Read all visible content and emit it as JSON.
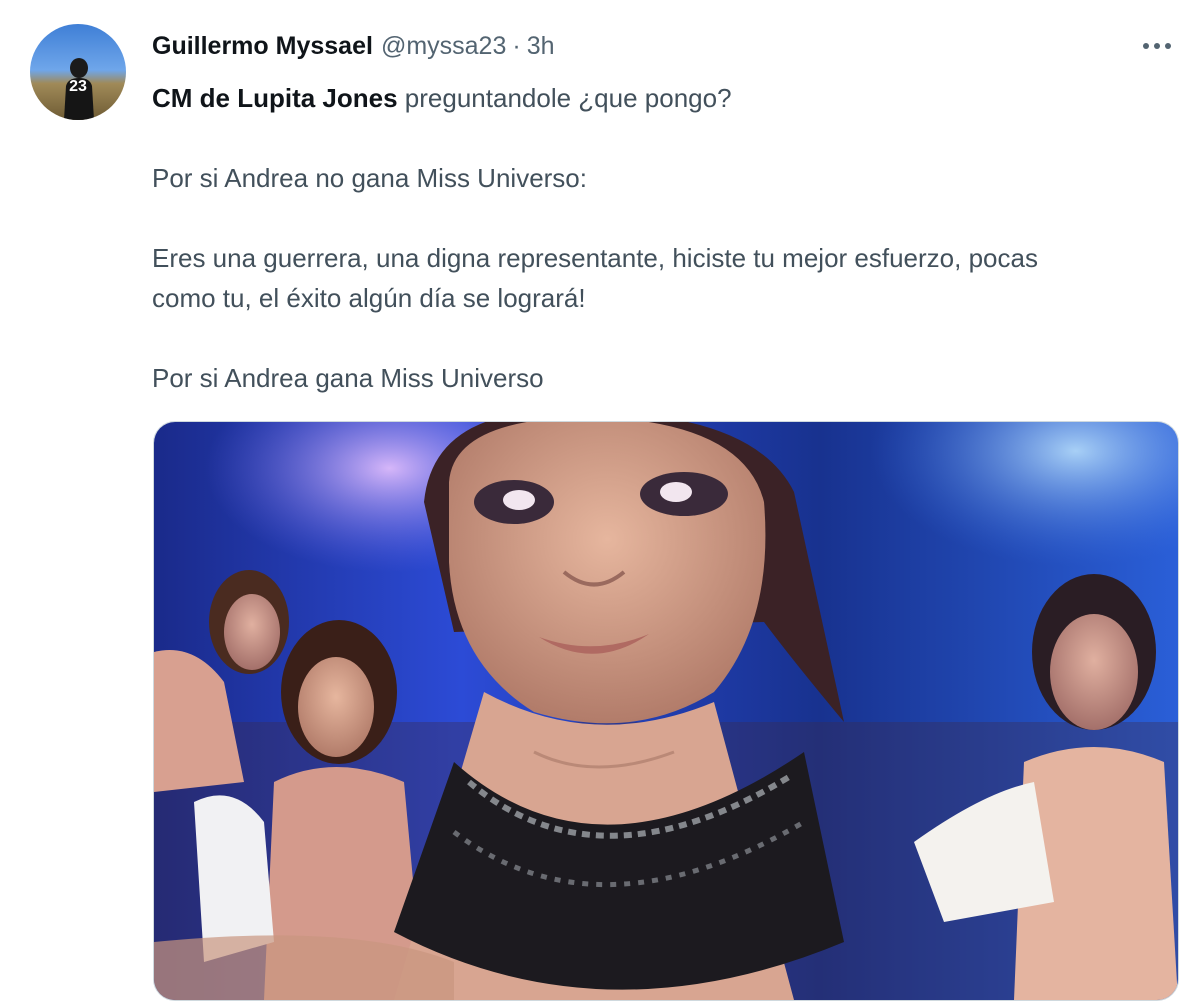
{
  "tweet": {
    "display_name": "Guillermo Myssael",
    "handle": "@myssa23",
    "separator": "·",
    "time": "3h",
    "avatar_label": "23",
    "lines": {
      "l1_bold": "CM de Lupita Jones",
      "l1_rest": " preguntandole ¿que pongo?",
      "l2": "Por si Andrea no gana Miss Universo:",
      "l3a": "Eres una guerrera, una digna representante, hiciste tu mejor esfuerzo, pocas",
      "l3b": "como tu, el éxito algún día se logrará!",
      "l4": "Por si Andrea gana Miss Universo"
    }
  },
  "icons": {
    "more": "more-horizontal-icon"
  },
  "colors": {
    "text": "#0f1419",
    "secondary": "#536471",
    "media_border": "#cfd9de"
  }
}
